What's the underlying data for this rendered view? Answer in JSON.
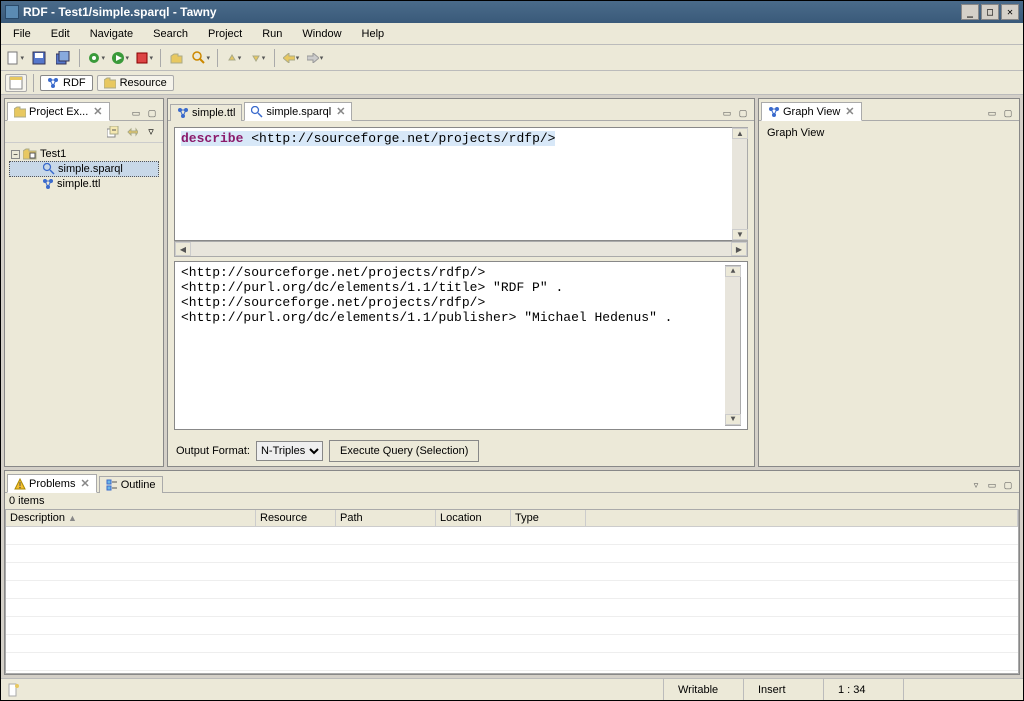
{
  "window": {
    "title": "RDF - Test1/simple.sparql - Tawny"
  },
  "menu": {
    "file": "File",
    "edit": "Edit",
    "navigate": "Navigate",
    "search": "Search",
    "project": "Project",
    "run": "Run",
    "window": "Window",
    "help": "Help"
  },
  "perspectives": {
    "rdf": "RDF",
    "resource": "Resource"
  },
  "project_explorer": {
    "title": "Project Ex...",
    "root": "Test1",
    "items": [
      "simple.sparql",
      "simple.ttl"
    ]
  },
  "editor": {
    "tab1": "simple.ttl",
    "tab2": "simple.sparql",
    "query_kw": "describe",
    "query_rest": " <http://sourceforge.net/projects/rdfp/>",
    "results": "<http://sourceforge.net/projects/rdfp/>\n<http://purl.org/dc/elements/1.1/title> \"RDF P\" .\n<http://sourceforge.net/projects/rdfp/>\n<http://purl.org/dc/elements/1.1/publisher> \"Michael Hedenus\" .",
    "output_format_label": "Output Format:",
    "output_format_value": "N-Triples",
    "execute_label": "Execute Query (Selection)"
  },
  "graph_view": {
    "title": "Graph View",
    "content": "Graph View"
  },
  "problems": {
    "tab_problems": "Problems",
    "tab_outline": "Outline",
    "count": "0 items",
    "cols": {
      "description": "Description",
      "resource": "Resource",
      "path": "Path",
      "location": "Location",
      "type": "Type"
    }
  },
  "status": {
    "writable": "Writable",
    "insert": "Insert",
    "pos": "1 : 34"
  }
}
